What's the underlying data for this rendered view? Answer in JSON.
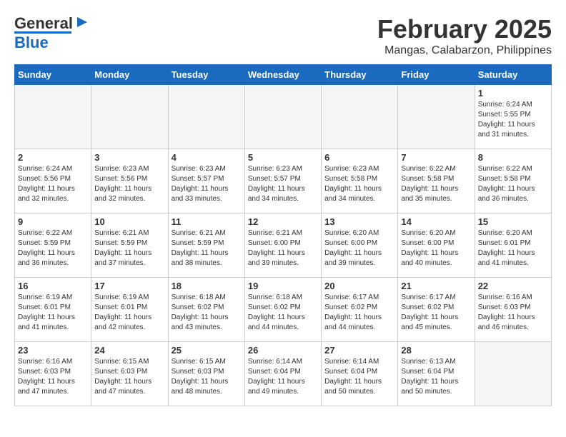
{
  "logo": {
    "text_general": "General",
    "text_blue": "Blue"
  },
  "title": "February 2025",
  "subtitle": "Mangas, Calabarzon, Philippines",
  "days_of_week": [
    "Sunday",
    "Monday",
    "Tuesday",
    "Wednesday",
    "Thursday",
    "Friday",
    "Saturday"
  ],
  "weeks": [
    [
      {
        "day": "",
        "info": ""
      },
      {
        "day": "",
        "info": ""
      },
      {
        "day": "",
        "info": ""
      },
      {
        "day": "",
        "info": ""
      },
      {
        "day": "",
        "info": ""
      },
      {
        "day": "",
        "info": ""
      },
      {
        "day": "1",
        "info": "Sunrise: 6:24 AM\nSunset: 5:55 PM\nDaylight: 11 hours\nand 31 minutes."
      }
    ],
    [
      {
        "day": "2",
        "info": "Sunrise: 6:24 AM\nSunset: 5:56 PM\nDaylight: 11 hours\nand 32 minutes."
      },
      {
        "day": "3",
        "info": "Sunrise: 6:23 AM\nSunset: 5:56 PM\nDaylight: 11 hours\nand 32 minutes."
      },
      {
        "day": "4",
        "info": "Sunrise: 6:23 AM\nSunset: 5:57 PM\nDaylight: 11 hours\nand 33 minutes."
      },
      {
        "day": "5",
        "info": "Sunrise: 6:23 AM\nSunset: 5:57 PM\nDaylight: 11 hours\nand 34 minutes."
      },
      {
        "day": "6",
        "info": "Sunrise: 6:23 AM\nSunset: 5:58 PM\nDaylight: 11 hours\nand 34 minutes."
      },
      {
        "day": "7",
        "info": "Sunrise: 6:22 AM\nSunset: 5:58 PM\nDaylight: 11 hours\nand 35 minutes."
      },
      {
        "day": "8",
        "info": "Sunrise: 6:22 AM\nSunset: 5:58 PM\nDaylight: 11 hours\nand 36 minutes."
      }
    ],
    [
      {
        "day": "9",
        "info": "Sunrise: 6:22 AM\nSunset: 5:59 PM\nDaylight: 11 hours\nand 36 minutes."
      },
      {
        "day": "10",
        "info": "Sunrise: 6:21 AM\nSunset: 5:59 PM\nDaylight: 11 hours\nand 37 minutes."
      },
      {
        "day": "11",
        "info": "Sunrise: 6:21 AM\nSunset: 5:59 PM\nDaylight: 11 hours\nand 38 minutes."
      },
      {
        "day": "12",
        "info": "Sunrise: 6:21 AM\nSunset: 6:00 PM\nDaylight: 11 hours\nand 39 minutes."
      },
      {
        "day": "13",
        "info": "Sunrise: 6:20 AM\nSunset: 6:00 PM\nDaylight: 11 hours\nand 39 minutes."
      },
      {
        "day": "14",
        "info": "Sunrise: 6:20 AM\nSunset: 6:00 PM\nDaylight: 11 hours\nand 40 minutes."
      },
      {
        "day": "15",
        "info": "Sunrise: 6:20 AM\nSunset: 6:01 PM\nDaylight: 11 hours\nand 41 minutes."
      }
    ],
    [
      {
        "day": "16",
        "info": "Sunrise: 6:19 AM\nSunset: 6:01 PM\nDaylight: 11 hours\nand 41 minutes."
      },
      {
        "day": "17",
        "info": "Sunrise: 6:19 AM\nSunset: 6:01 PM\nDaylight: 11 hours\nand 42 minutes."
      },
      {
        "day": "18",
        "info": "Sunrise: 6:18 AM\nSunset: 6:02 PM\nDaylight: 11 hours\nand 43 minutes."
      },
      {
        "day": "19",
        "info": "Sunrise: 6:18 AM\nSunset: 6:02 PM\nDaylight: 11 hours\nand 44 minutes."
      },
      {
        "day": "20",
        "info": "Sunrise: 6:17 AM\nSunset: 6:02 PM\nDaylight: 11 hours\nand 44 minutes."
      },
      {
        "day": "21",
        "info": "Sunrise: 6:17 AM\nSunset: 6:02 PM\nDaylight: 11 hours\nand 45 minutes."
      },
      {
        "day": "22",
        "info": "Sunrise: 6:16 AM\nSunset: 6:03 PM\nDaylight: 11 hours\nand 46 minutes."
      }
    ],
    [
      {
        "day": "23",
        "info": "Sunrise: 6:16 AM\nSunset: 6:03 PM\nDaylight: 11 hours\nand 47 minutes."
      },
      {
        "day": "24",
        "info": "Sunrise: 6:15 AM\nSunset: 6:03 PM\nDaylight: 11 hours\nand 47 minutes."
      },
      {
        "day": "25",
        "info": "Sunrise: 6:15 AM\nSunset: 6:03 PM\nDaylight: 11 hours\nand 48 minutes."
      },
      {
        "day": "26",
        "info": "Sunrise: 6:14 AM\nSunset: 6:04 PM\nDaylight: 11 hours\nand 49 minutes."
      },
      {
        "day": "27",
        "info": "Sunrise: 6:14 AM\nSunset: 6:04 PM\nDaylight: 11 hours\nand 50 minutes."
      },
      {
        "day": "28",
        "info": "Sunrise: 6:13 AM\nSunset: 6:04 PM\nDaylight: 11 hours\nand 50 minutes."
      },
      {
        "day": "",
        "info": ""
      }
    ]
  ]
}
